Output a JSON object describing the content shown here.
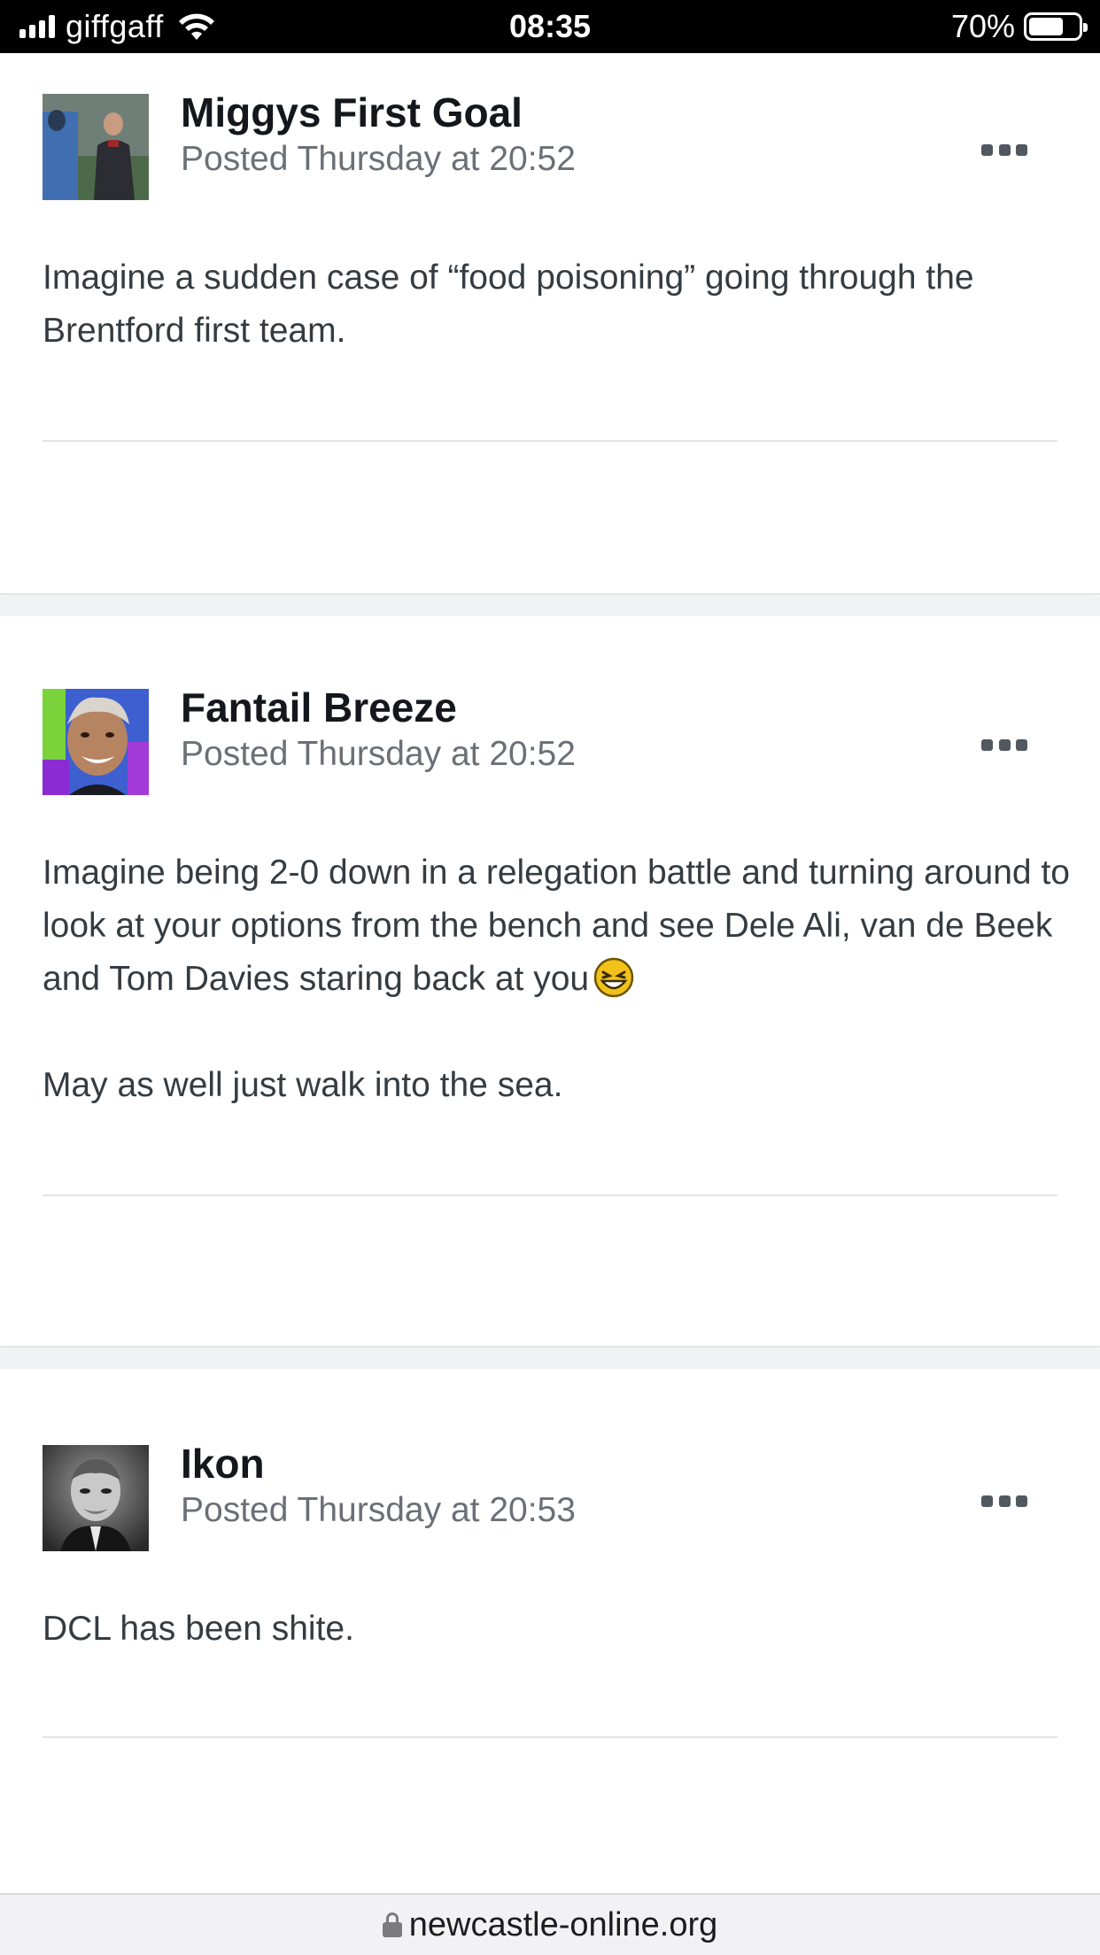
{
  "status_bar": {
    "carrier": "giffgaff",
    "time": "08:35",
    "battery_percent": "70%",
    "battery_level": 0.7,
    "icons": [
      "signal-icon",
      "wifi-icon",
      "battery-icon"
    ]
  },
  "posts": [
    {
      "author": "Miggys First Goal",
      "posted": "Posted Thursday at 20:52",
      "body": [
        "Imagine a sudden case of “food poisoning” going through the Brentford first team."
      ]
    },
    {
      "author": "Fantail Breeze",
      "posted": "Posted Thursday at 20:52",
      "body": [
        "Imagine being 2-0 down in a relegation battle and turning around to look at your options from the bench and see Dele Ali, van de Beek and Tom Davies staring back at you",
        "May as well just walk into the sea."
      ]
    },
    {
      "author": "Ikon",
      "posted": "Posted Thursday at 20:53",
      "body": [
        "DCL has been shite."
      ]
    }
  ],
  "url_bar": {
    "url": "newcastle-online.org"
  },
  "colors": {
    "author": "#14171c",
    "meta": "#6b7077",
    "body": "#353c41",
    "divider": "#e1e4e7",
    "gap": "#f1f2f4"
  }
}
